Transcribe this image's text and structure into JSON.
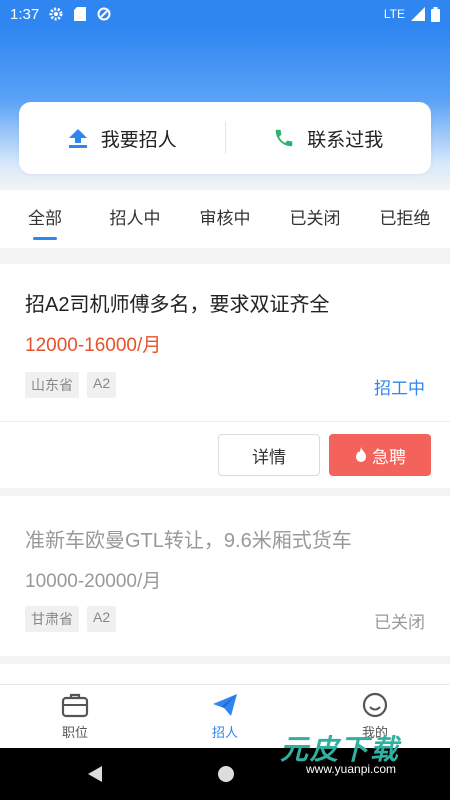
{
  "status_bar": {
    "time": "1:37",
    "network": "LTE"
  },
  "actions": {
    "post_job": "我要招人",
    "contacted": "联系过我"
  },
  "tabs": [
    {
      "label": "全部",
      "active": true
    },
    {
      "label": "招人中",
      "active": false
    },
    {
      "label": "审核中",
      "active": false
    },
    {
      "label": "已关闭",
      "active": false
    },
    {
      "label": "已拒绝",
      "active": false
    }
  ],
  "jobs": [
    {
      "title": "招A2司机师傅多名，要求双证齐全",
      "salary": "12000-16000/月",
      "tags": [
        "山东省",
        "A2"
      ],
      "status": "招工中",
      "detail_label": "详情",
      "urgent_label": "急聘"
    },
    {
      "title": "准新车欧曼GTL转让，9.6米厢式货车",
      "salary": "10000-20000/月",
      "tags": [
        "甘肃省",
        "A2"
      ],
      "status": "已关闭"
    }
  ],
  "bottom_nav": [
    {
      "label": "职位",
      "icon": "briefcase-icon",
      "active": false
    },
    {
      "label": "招人",
      "icon": "paper-plane-icon",
      "active": true
    },
    {
      "label": "我的",
      "icon": "smiley-icon",
      "active": false
    }
  ],
  "watermark": {
    "text": "元皮下载",
    "url": "www.yuanpi.com"
  },
  "colors": {
    "primary": "#2f86f0",
    "salary_active": "#e8512c",
    "urgent": "#f3625b",
    "status_active": "#2f86f0",
    "inactive": "#999999"
  }
}
